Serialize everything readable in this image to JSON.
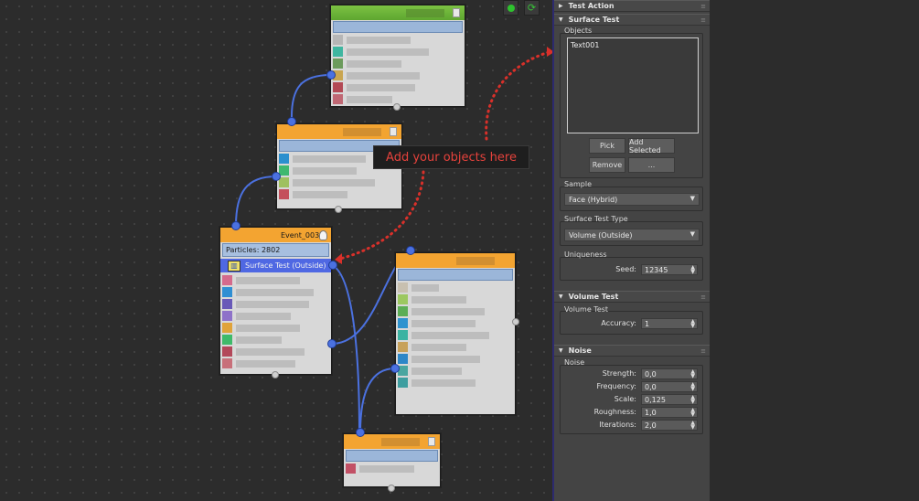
{
  "callout": {
    "text": "Add your objects here"
  },
  "event_node": {
    "title": "Event_003",
    "particles": "Particles: 2802",
    "surface_operator": "Surface Test (Outside)"
  },
  "panel": {
    "rollouts": {
      "test_action": "Test Action",
      "surface_test": "Surface Test",
      "volume_test": "Volume Test",
      "noise": "Noise"
    },
    "objects": {
      "label": "Objects",
      "items": [
        "Text001"
      ],
      "pick": "Pick",
      "add_selected": "Add Selected",
      "remove": "Remove",
      "more": "..."
    },
    "sample": {
      "label": "Sample",
      "value": "Face (Hybrid)"
    },
    "surface_test_type": {
      "label": "Surface Test Type",
      "value": "Volume (Outside)"
    },
    "uniqueness": {
      "label": "Uniqueness",
      "seed_label": "Seed:",
      "seed_value": "12345"
    },
    "volume": {
      "label": "Volume Test",
      "accuracy_label": "Accuracy:",
      "accuracy_value": "1"
    },
    "noise": {
      "label": "Noise",
      "strength_label": "Strength:",
      "strength_value": "0,0",
      "frequency_label": "Frequency:",
      "frequency_value": "0,0",
      "scale_label": "Scale:",
      "scale_value": "0,125",
      "roughness_label": "Roughness:",
      "roughness_value": "1,0",
      "iterations_label": "Iterations:",
      "iterations_value": "2,0"
    }
  },
  "colors": {
    "accent_orange": "#f3a431",
    "accent_green": "#6fb83a",
    "wire_blue": "#4b71e0",
    "callout_red": "#e5423c"
  }
}
